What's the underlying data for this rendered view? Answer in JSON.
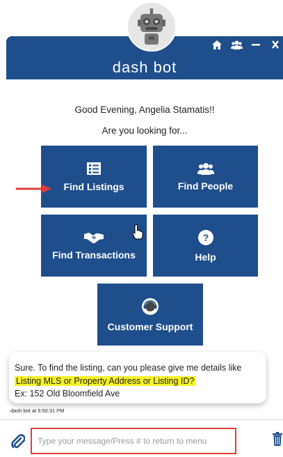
{
  "header": {
    "title": "dash bot",
    "icons": [
      "home-icon",
      "people-icon",
      "minimize-icon",
      "close-icon"
    ]
  },
  "greeting": "Good Evening, Angelia Stamatis!!",
  "question": "Are you looking for...",
  "options": [
    {
      "label": "Find Listings",
      "icon": "listings-icon"
    },
    {
      "label": "Find People",
      "icon": "people-icon"
    },
    {
      "label": "Find Transactions",
      "icon": "handshake-icon"
    },
    {
      "label": "Help",
      "icon": "question-icon"
    },
    {
      "label": "Customer Support",
      "icon": "headset-icon"
    }
  ],
  "message": {
    "line1": "Sure. To find the listing, can you please give me details like",
    "line2_highlight": "Listing MLS or Property Address or Listing ID?",
    "line3": "Ex: 152 Old Bloomfield Ave",
    "timestamp": "dash bot at 6:50:31 PM"
  },
  "composer": {
    "placeholder": "Type your message/Press # to return to menu",
    "value": ""
  },
  "colors": {
    "brand": "#1f4e8c",
    "highlight": "#f5f227",
    "input_border": "#e23b3b",
    "arrow": "#e23b3b"
  }
}
